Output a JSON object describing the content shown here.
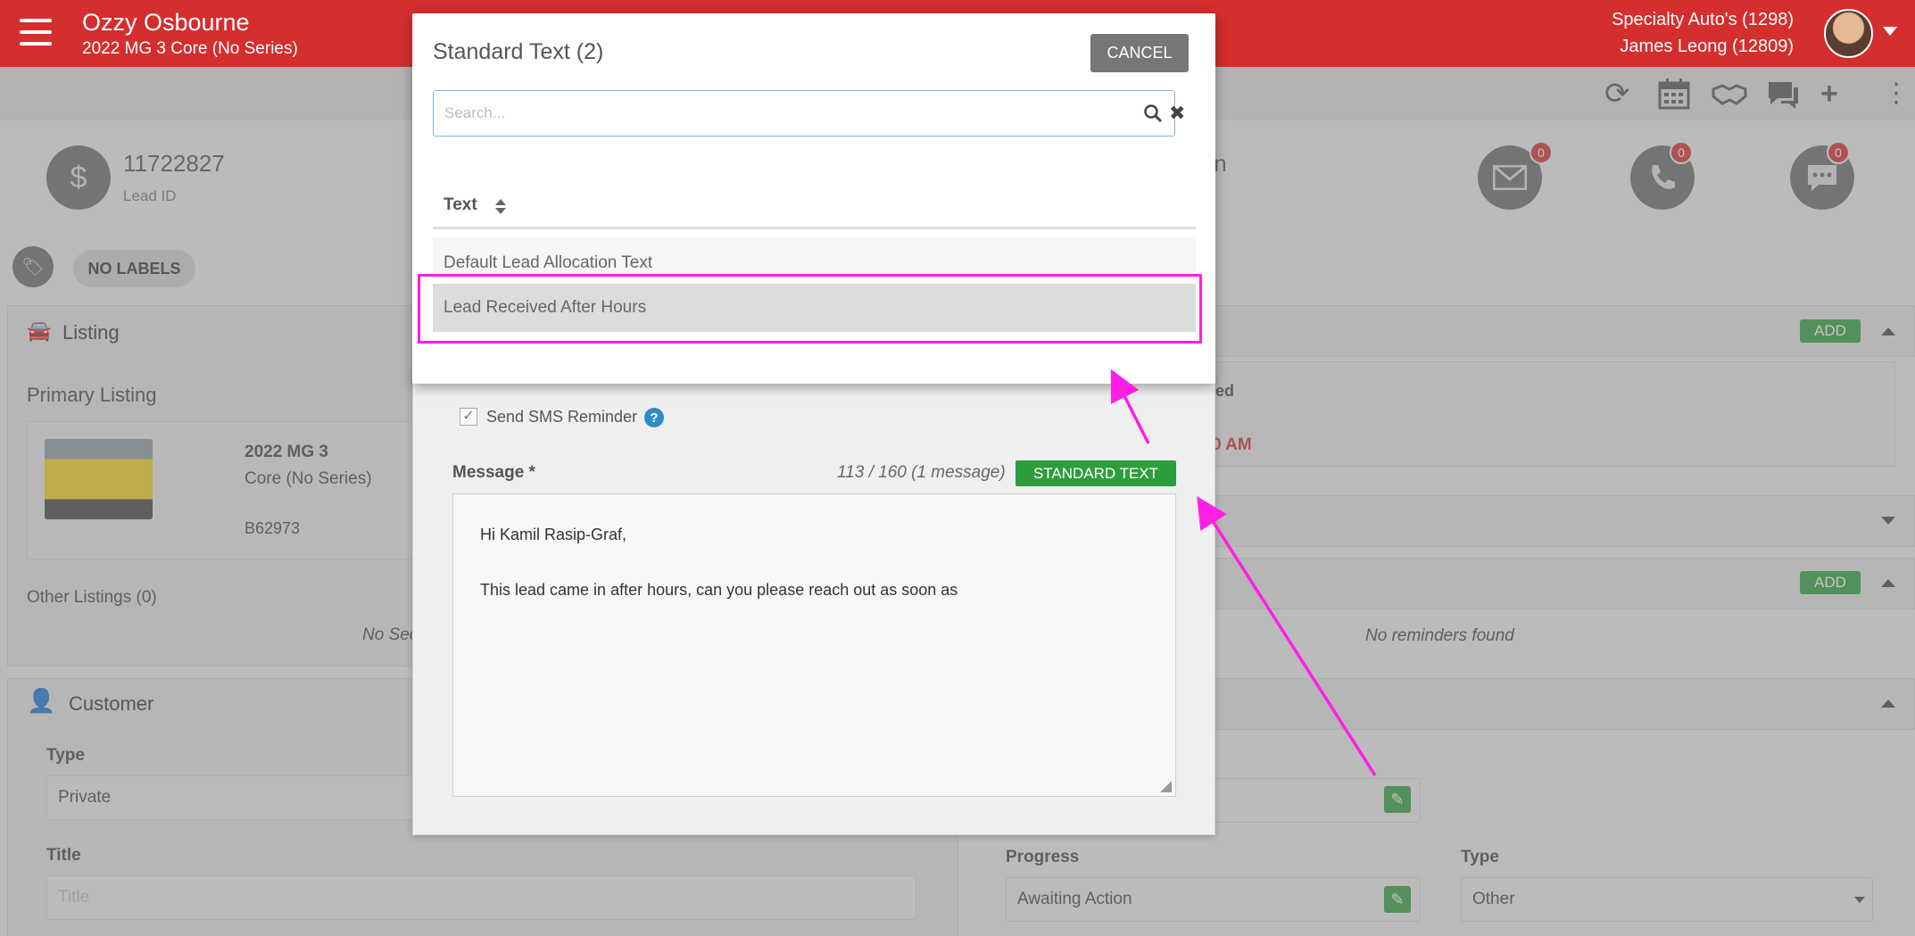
{
  "header": {
    "user_name": "Ozzy Osbourne",
    "user_sub": "2022 MG 3 Core (No Series)",
    "dealer": "Specialty Auto's (1298)",
    "agent": "James Leong (12809)"
  },
  "lead": {
    "id": "11722827",
    "id_label": "Lead ID",
    "title_fragment": "ion"
  },
  "comms": {
    "email_count": "0",
    "phone_count": "0",
    "chat_count": "0"
  },
  "labels": {
    "pill": "NO LABELS"
  },
  "listing": {
    "title": "Listing",
    "primary": "Primary Listing",
    "car_title": "2022 MG 3",
    "car_sub": "Core (No Series)",
    "stock": "B62973",
    "other": "Other Listings (0)",
    "other_empty": "No Sec"
  },
  "right_panel": {
    "add_label": "ADD",
    "status_frag": "ed",
    "time_frag": "0 AM",
    "reminders_empty": "No reminders found",
    "progress_label": "Progress",
    "progress_value": "Awaiting Action",
    "type_label": "Type",
    "type_value": "Other"
  },
  "customer": {
    "title": "Customer",
    "type_label": "Type",
    "type_value": "Private",
    "title_label": "Title",
    "title_placeholder": "Title"
  },
  "sms": {
    "reminder_label": "Send SMS Reminder",
    "message_label": "Message *",
    "counter": "113 / 160 (1 message)",
    "std_button": "STANDARD TEXT",
    "line1": "Hi Kamil Rasip-Graf,",
    "line2": "This lead came in after hours, can you please reach out as soon as"
  },
  "modal": {
    "title": "Standard Text (2)",
    "cancel": "CANCEL",
    "search_placeholder": "Search...",
    "column": "Text",
    "rows": [
      "Default Lead Allocation Text",
      "Lead Received After Hours"
    ]
  },
  "colors": {
    "brand": "#d42e2e",
    "success": "#2e9d3e",
    "highlight": "#ff1fe5"
  }
}
